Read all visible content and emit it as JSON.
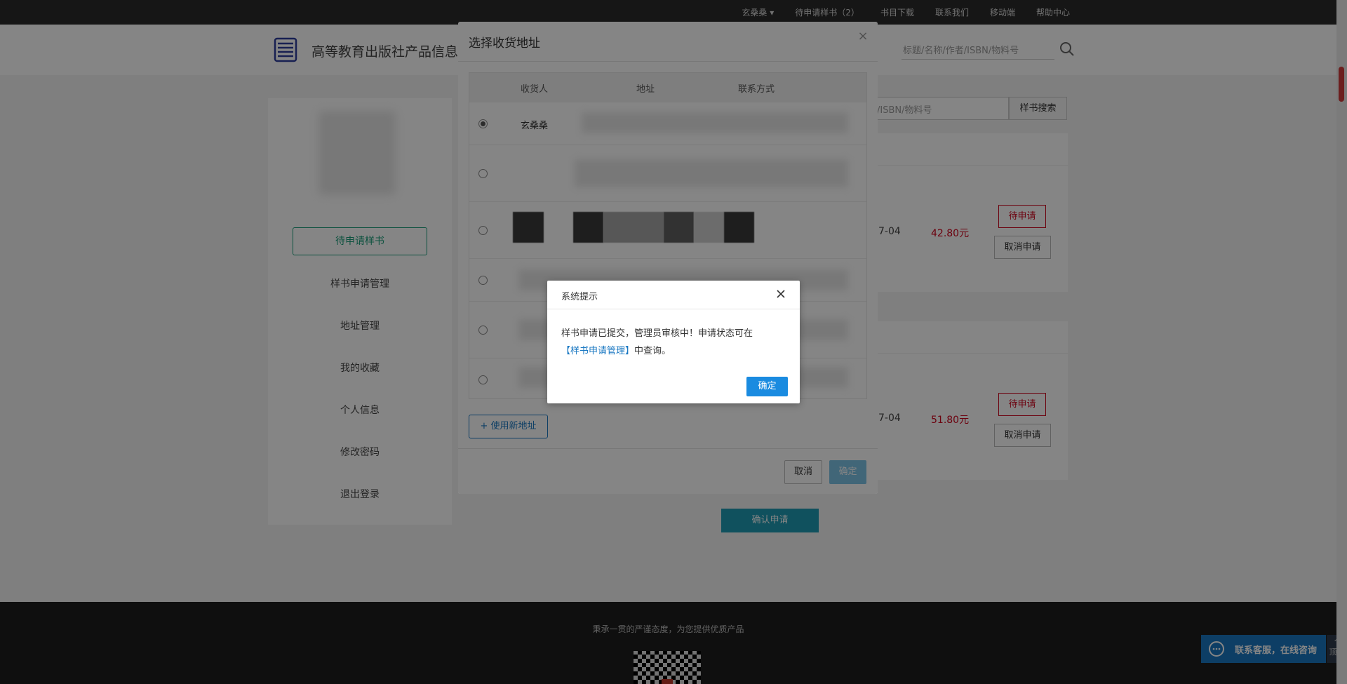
{
  "topbar": {
    "user": "玄桑桑",
    "pending_samples": "待申请样书（2）",
    "catalog_download": "书目下载",
    "contact_us": "联系我们",
    "mobile": "移动端",
    "help_center": "帮助中心"
  },
  "header": {
    "site_title": "高等教育出版社产品信息检",
    "search_placeholder": "标题/名称/作者/ISBN/物料号"
  },
  "sidebar": {
    "items": [
      {
        "label": "待申请样书",
        "active": true
      },
      {
        "label": "样书申请管理"
      },
      {
        "label": "地址管理"
      },
      {
        "label": "我的收藏"
      },
      {
        "label": "个人信息"
      },
      {
        "label": "修改密码"
      },
      {
        "label": "退出登录"
      }
    ]
  },
  "main": {
    "search_placeholder": "者/ISBN/物料号",
    "search_button": "样书搜索",
    "books": [
      {
        "date": "7-04",
        "price": "42.80元",
        "status_button": "待申请",
        "cancel_button": "取消申请"
      },
      {
        "date": "7-04",
        "price": "51.80元",
        "status_button": "待申请",
        "cancel_button": "取消申请"
      }
    ],
    "confirm_apply": "确认申请"
  },
  "footer": {
    "slogan": "秉承一贯的严谨态度，为您提供优质产品",
    "chat": "联系客服，在线咨询",
    "to_top": "顶部"
  },
  "address_modal": {
    "title": "选择收货地址",
    "columns": [
      "收货人",
      "地址",
      "联系方式"
    ],
    "rows": [
      {
        "recipient": "玄桑桑",
        "selected": true
      },
      {
        "recipient": ""
      },
      {
        "recipient": ""
      },
      {
        "recipient": ""
      },
      {
        "recipient": ""
      },
      {
        "recipient": ""
      }
    ],
    "new_address": "使用新地址",
    "cancel": "取消",
    "ok": "确定"
  },
  "system_dialog": {
    "title": "系统提示",
    "message_prefix": "样书申请已提交，管理员审核中！申请状态可在",
    "message_link": "【样书申请管理】",
    "message_suffix": "中查询。",
    "ok": "确定"
  },
  "colors": {
    "accent_green": "#1a9d7a",
    "price_red": "#d0021b",
    "link_blue": "#1a78c2",
    "button_blue": "#1a8be0"
  }
}
